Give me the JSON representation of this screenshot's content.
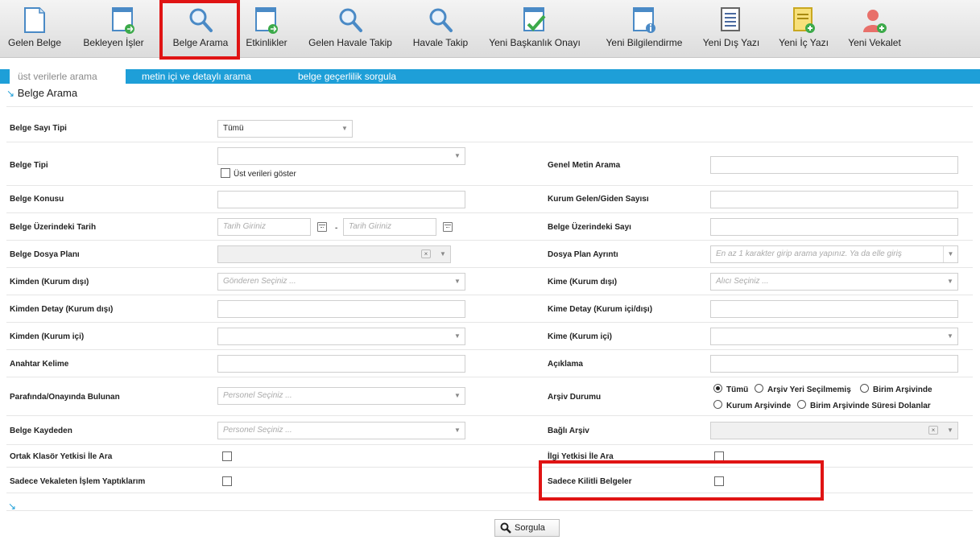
{
  "toolbar": {
    "items": [
      {
        "label": "Gelen Belge",
        "icon": "document-icon"
      },
      {
        "label": "Bekleyen İşler",
        "icon": "document-forward-icon"
      },
      {
        "label": "Belge Arama",
        "icon": "search-icon"
      },
      {
        "label": "Etkinlikler",
        "icon": "document-forward-icon"
      },
      {
        "label": "Gelen Havale Takip",
        "icon": "search-icon"
      },
      {
        "label": "Havale Takip",
        "icon": "search-icon"
      },
      {
        "label": "Yeni Başkanlık Onayı",
        "icon": "document-check-icon"
      },
      {
        "label": "Yeni Bilgilendirme",
        "icon": "document-info-icon"
      },
      {
        "label": "Yeni Dış Yazı",
        "icon": "list-document-icon"
      },
      {
        "label": "Yeni İç Yazı",
        "icon": "document-add-icon"
      },
      {
        "label": "Yeni Vekalet",
        "icon": "user-add-icon"
      }
    ]
  },
  "tabs": [
    {
      "label": "üst verilerle arama",
      "active": true
    },
    {
      "label": "metin içi ve detaylı arama",
      "active": false
    },
    {
      "label": "belge geçerlilik sorgula",
      "active": false
    }
  ],
  "section_title": "Belge Arama",
  "form": {
    "belge_sayi_tipi": {
      "label": "Belge Sayı Tipi",
      "value": "Tümü"
    },
    "belge_tipi": {
      "label": "Belge Tipi",
      "checkbox_label": "Üst verileri göster"
    },
    "genel_metin": {
      "label": "Genel Metin Arama"
    },
    "belge_konusu": {
      "label": "Belge Konusu"
    },
    "kurum_sayisi": {
      "label": "Kurum Gelen/Giden Sayısı"
    },
    "belge_tarih": {
      "label": "Belge Üzerindeki Tarih",
      "placeholder1": "Tarih Giriniz",
      "placeholder2": "Tarih Giriniz",
      "sep": "-"
    },
    "belge_sayi": {
      "label": "Belge Üzerindeki Sayı"
    },
    "dosya_plani": {
      "label": "Belge Dosya Planı"
    },
    "dosya_ayrinti": {
      "label": "Dosya Plan Ayrıntı",
      "placeholder": "En az 1 karakter girip arama yapınız. Ya da elle giriş"
    },
    "kimden_disi": {
      "label": "Kimden (Kurum dışı)",
      "placeholder": "Gönderen Seçiniz ..."
    },
    "kime_disi": {
      "label": "Kime (Kurum dışı)",
      "placeholder": "Alıcı Seçiniz ..."
    },
    "kimden_detay": {
      "label": "Kimden Detay (Kurum dışı)"
    },
    "kime_detay": {
      "label": "Kime Detay (Kurum içi/dışı)"
    },
    "kimden_ici": {
      "label": "Kimden (Kurum içi)"
    },
    "kime_ici": {
      "label": "Kime (Kurum içi)"
    },
    "anahtar": {
      "label": "Anahtar Kelime"
    },
    "aciklama": {
      "label": "Açıklama"
    },
    "parafinda": {
      "label": "Parafında/Onayında Bulunan",
      "placeholder": "Personel Seçiniz ..."
    },
    "arsiv_durumu": {
      "label": "Arşiv Durumu",
      "options": [
        "Tümü",
        "Arşiv Yeri Seçilmemiş",
        "Birim Arşivinde",
        "Kurum Arşivinde",
        "Birim Arşivinde Süresi Dolanlar"
      ],
      "selected": "Tümü"
    },
    "kaydeden": {
      "label": "Belge Kaydeden",
      "placeholder": "Personel Seçiniz ..."
    },
    "bagli_arsiv": {
      "label": "Bağlı Arşiv"
    },
    "ortak_klasor": {
      "label": "Ortak Klasör Yetkisi İle Ara"
    },
    "ilgi_yetkisi": {
      "label": "İlgi Yetkisi İle Ara"
    },
    "vekaleten": {
      "label": "Sadece Vekaleten İşlem Yaptıklarım"
    },
    "kilitli": {
      "label": "Sadece Kilitli Belgeler"
    }
  },
  "search_button": {
    "label": "Sorgula",
    "icon": "search-icon"
  },
  "colors": {
    "accent": "#1e9fd8",
    "highlight": "#e01414"
  }
}
